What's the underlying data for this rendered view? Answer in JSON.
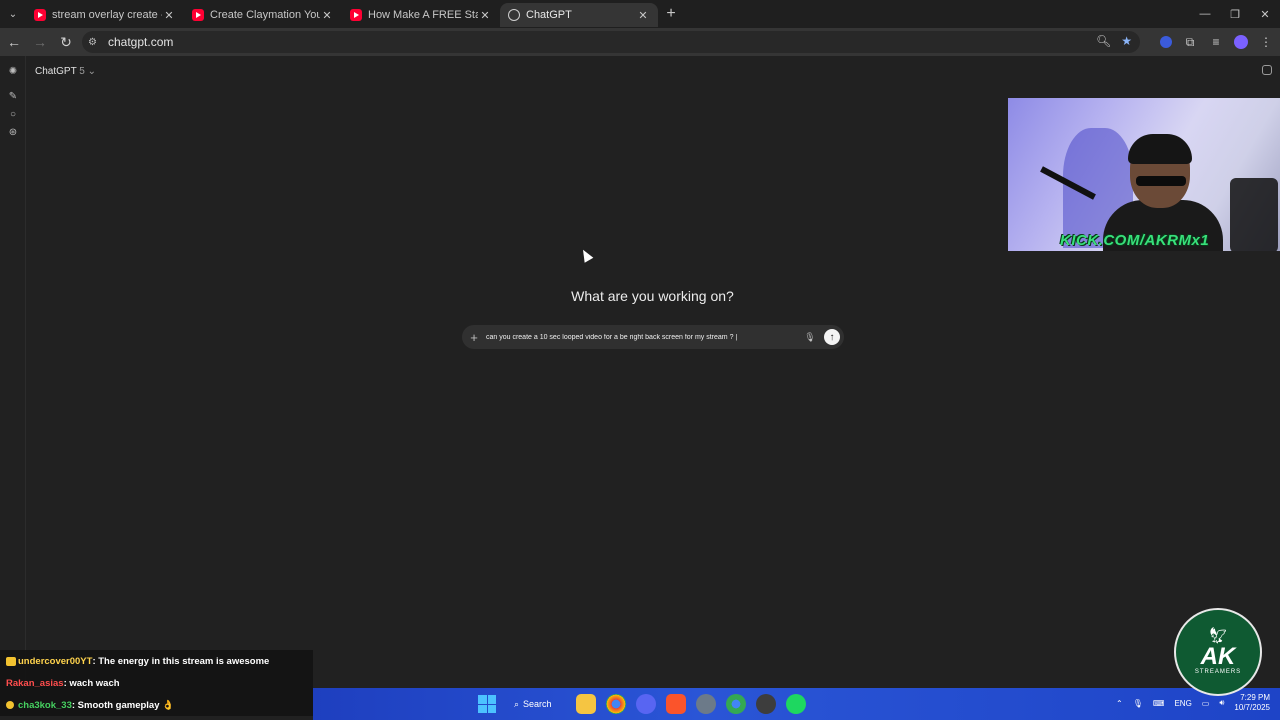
{
  "browser": {
    "tabs": [
      {
        "title": "stream overlay create - YouTube",
        "icon": "youtube-icon",
        "active": false
      },
      {
        "title": "Create Claymation YouTube & ...",
        "icon": "youtube-icon",
        "active": false
      },
      {
        "title": "How Make A FREE Starting Soon",
        "icon": "youtube-icon",
        "active": false
      },
      {
        "title": "ChatGPT",
        "icon": "chatgpt-icon",
        "active": true
      }
    ],
    "url": "chatgpt.com"
  },
  "page": {
    "model_name": "ChatGPT",
    "model_version": "5",
    "headline": "What are you working on?",
    "prompt_text": "can you create a 10 sec looped video for a be right back screen for my stream ? |"
  },
  "webcam": {
    "label": "KICK.COM/AKRMx1"
  },
  "chat": [
    {
      "user": "undercover00YT",
      "message": ": The energy in this stream is awesome"
    },
    {
      "user": "Rakan_asias",
      "message": ": wach wach"
    },
    {
      "user": "cha3kok_33",
      "message": ": Smooth gameplay 👌"
    }
  ],
  "logo": {
    "top": "AK",
    "bottom": "STREAMERS"
  },
  "taskbar": {
    "search_label": "Search",
    "lang": "ENG",
    "time": "7:29 PM",
    "date": "10/7/2025"
  },
  "colors": {
    "page_bg": "#212121",
    "kick_green": "#38e07b",
    "taskbar_blue": "#2a55d6"
  }
}
